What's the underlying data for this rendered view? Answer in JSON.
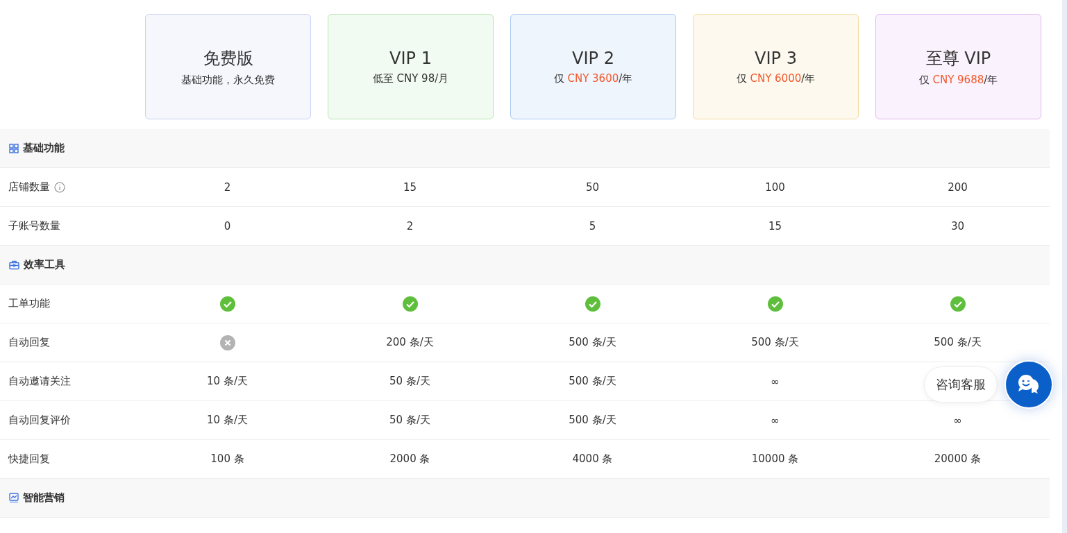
{
  "plans": [
    {
      "title": "免费版",
      "color": "#c9d3f2",
      "subtitle": [
        {
          "text": "基础功能，永久免费",
          "highlight": false
        }
      ]
    },
    {
      "title": "VIP 1",
      "color": "#b8e6b0",
      "subtitle": [
        {
          "text": "低至 CNY 98/月",
          "highlight": false
        }
      ]
    },
    {
      "title": "VIP 2",
      "color": "#a8c8f0",
      "subtitle": [
        {
          "text": "仅 ",
          "highlight": false
        },
        {
          "text": "CNY 3600",
          "highlight": true
        },
        {
          "text": "/年",
          "highlight": false
        }
      ]
    },
    {
      "title": "VIP 3",
      "color": "#f6dca0",
      "subtitle": [
        {
          "text": "仅 ",
          "highlight": false
        },
        {
          "text": "CNY 6000",
          "highlight": true
        },
        {
          "text": "/年",
          "highlight": false
        }
      ]
    },
    {
      "title": "至尊 VIP",
      "color": "#e3b9f0",
      "subtitle": [
        {
          "text": "仅 ",
          "highlight": false
        },
        {
          "text": "CNY 9688",
          "highlight": true
        },
        {
          "text": "/年",
          "highlight": false
        }
      ]
    }
  ],
  "sections": [
    {
      "title": "基础功能",
      "rows": [
        {
          "label": "店铺数量",
          "info": true,
          "cells": [
            {
              "kind": "text",
              "text": "2"
            },
            {
              "kind": "text",
              "text": "15"
            },
            {
              "kind": "text",
              "text": "50"
            },
            {
              "kind": "text",
              "text": "100"
            },
            {
              "kind": "text",
              "text": "200"
            }
          ]
        },
        {
          "label": "子账号数量",
          "info": false,
          "cells": [
            {
              "kind": "text",
              "text": "0"
            },
            {
              "kind": "text",
              "text": "2"
            },
            {
              "kind": "text",
              "text": "5"
            },
            {
              "kind": "text",
              "text": "15"
            },
            {
              "kind": "text",
              "text": "30"
            }
          ]
        }
      ]
    },
    {
      "title": "效率工具",
      "rows": [
        {
          "label": "工单功能",
          "info": false,
          "cells": [
            {
              "kind": "check"
            },
            {
              "kind": "check"
            },
            {
              "kind": "check"
            },
            {
              "kind": "check"
            },
            {
              "kind": "check"
            }
          ]
        },
        {
          "label": "自动回复",
          "info": false,
          "cells": [
            {
              "kind": "cross"
            },
            {
              "kind": "text",
              "text": "200 条/天"
            },
            {
              "kind": "text",
              "text": "500 条/天"
            },
            {
              "kind": "text",
              "text": "500 条/天"
            },
            {
              "kind": "text",
              "text": "500 条/天"
            }
          ]
        },
        {
          "label": "自动邀请关注",
          "info": false,
          "cells": [
            {
              "kind": "text",
              "text": "10 条/天"
            },
            {
              "kind": "text",
              "text": "50 条/天"
            },
            {
              "kind": "text",
              "text": "500 条/天"
            },
            {
              "kind": "text",
              "text": "∞"
            }
          ]
        },
        {
          "label": "自动回复评价",
          "info": false,
          "cells": [
            {
              "kind": "text",
              "text": "10 条/天"
            },
            {
              "kind": "text",
              "text": "50 条/天"
            },
            {
              "kind": "text",
              "text": "500 条/天"
            },
            {
              "kind": "text",
              "text": "∞"
            },
            {
              "kind": "text",
              "text": "∞"
            }
          ]
        },
        {
          "label": "快捷回复",
          "info": false,
          "cells": [
            {
              "kind": "text",
              "text": "100 条"
            },
            {
              "kind": "text",
              "text": "2000 条"
            },
            {
              "kind": "text",
              "text": "4000 条"
            },
            {
              "kind": "text",
              "text": "10000 条"
            },
            {
              "kind": "text",
              "text": "20000 条"
            }
          ]
        }
      ]
    },
    {
      "title": "智能营销"
    }
  ],
  "support": {
    "label": "咨询客服"
  }
}
